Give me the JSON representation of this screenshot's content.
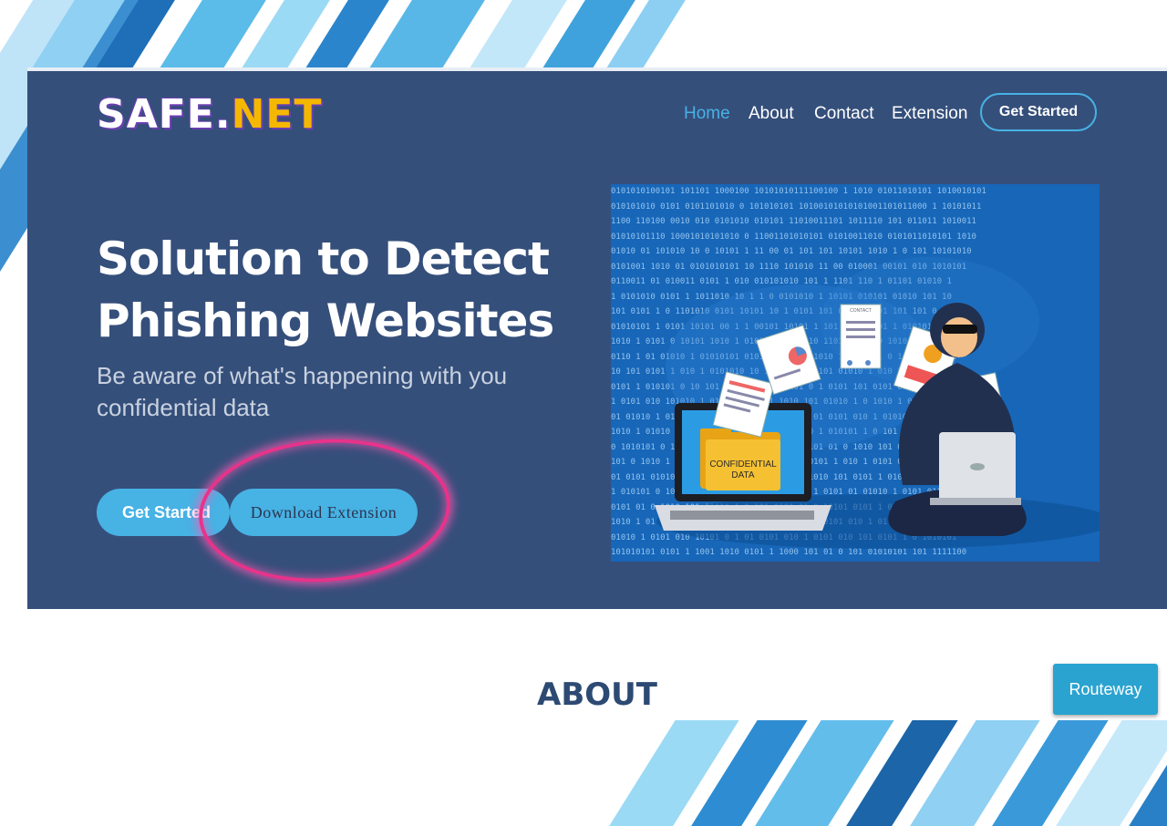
{
  "brand": {
    "part1": "SAFE.",
    "part2": "NET",
    "accent_color": "#f5b800",
    "outline_color": "#6a3fb0"
  },
  "nav": {
    "items": [
      {
        "label": "Home",
        "active": true
      },
      {
        "label": "About",
        "active": false
      },
      {
        "label": "Contact",
        "active": false
      },
      {
        "label": "Extension",
        "active": false
      }
    ],
    "cta_label": "Get Started"
  },
  "hero": {
    "headline_line1": "Solution to Detect",
    "headline_line2": "Phishing Websites",
    "subtitle_line1": "Be aware of what's happening with you",
    "subtitle_line2": "confidential data",
    "primary_button": "Get Started",
    "secondary_button": "Download Extension",
    "background_color": "#354f7b",
    "button_color": "#47b2e4",
    "highlight_color": "#e8338a"
  },
  "illustration": {
    "folder_label_line1": "CONFIDENTIAL",
    "folder_label_line2": "DATA",
    "doc_label": "CONTACT",
    "binary_rows": [
      "0101010100101 101101 1000100 10101010111100100 1 1010 01011010101 1010010101",
      "010101010 0101 0101101010 0 101010101 10100101010101001101011000 1 10101011",
      "1100 110100 0010 010 0101010 010101 11010011101 1011110 101 011011 1010011",
      "01010101110 10001010101010 0 11001101010101 01010011010 0101011010101 1010",
      "01010 01 101010 10 0 10101 1 11 00 01 101 101 10101 1010 1 0 101 10101010",
      "0101001 1010 01 0101010101 10 1110 101010 11 00 010001 00101 010 1010101",
      "0110011 01 010011 0101 1 010 010101010 101 1 1101 110 1 01101 01010 1",
      "1 0101010 0101 1 1011010 10 1 1 0 0101010 1 10101 010101 01010 101 10",
      "101 0101 1 0 1101010 0101 10101 10 1 0101 101 0101 00101 101 101 0 110",
      "01010101 1 0101 10101 00 1 1 00101 10101 1 101 01010 101 1 010101 011",
      "1010 1 0101 0 10101 1010 1 0101 1010 1 010 1101 01010 0 101010 1 0101",
      "0110 1 01 01010 1 01010101 0101 1 0101 0 1010 1 01010 1 0 10101 010101",
      "10 101 0101 1 010 1 0101010 10 1 0101 010 101 01010 1 010 10101 10101",
      "0101 1 010101 0 10 101 01 0101 1 010101 0 1 0101 101 0101 010 10101 01",
      "1 0101 010 101010 1 01 0101 010 1 1010 101 01010 1 0 1010 1 010 1010101",
      "01 01010 1 0101 01 010 10101 01 0 1010 1 01 0101 010 1 010101 101 0101",
      "1010 1 01010 101 0 10101 01 010 1 0101 10 1 010101 1 0 101 0101 01010",
      "0 1010101 0 1010 101 01 0 1 0101 010 1 0101 01 0 1010 101 01010 10101",
      "101 0 1010 1 01010 1 0101 01 0 10101 01 0101 1 010 1 0101 010101 0101",
      "01 0101 01010 1 0101 0 1 01010 101 01 0 1010 101 0101 1 01010 1 01010",
      "1 010101 0 101 0101 1 010 10101 1 01 010 1 0101 01 01010 1 0101 010101",
      "0101 01 0 1010 101 01010 1 0 101 0101 01 0 10101 0101 1 01 0101 010101",
      "1010 1 01 0101 01010 101 0 1 010 1010 1 01 0101 010 1 01 0 1010 1010101",
      "01010 1 0101 010 10101 0 1 01 0101 010 1 0101 010 101 0101 1 0 1010101",
      "101010101 0101 1 1001 1010 0101 1 1000 101 01 0 101 01010101 101 1111100"
    ]
  },
  "about": {
    "title": "ABOUT"
  },
  "floating_button": {
    "label": "Routeway"
  }
}
